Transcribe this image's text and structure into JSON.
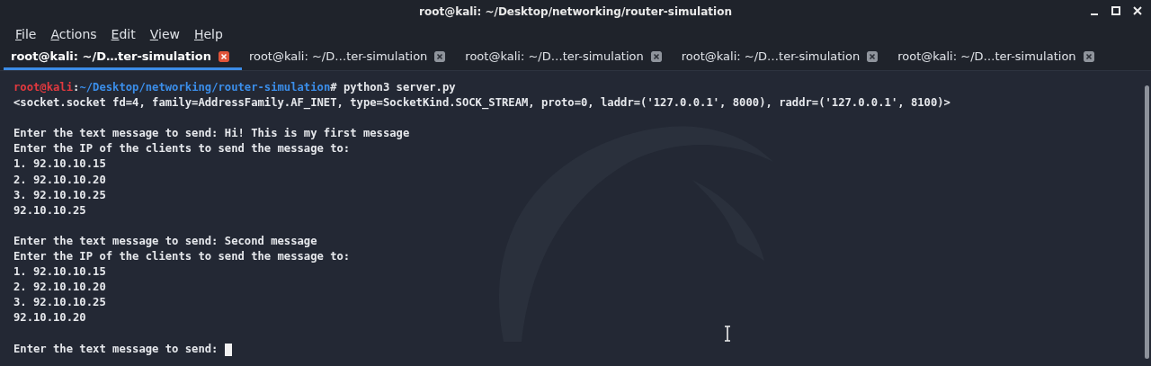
{
  "window": {
    "title": "root@kali: ~/Desktop/networking/router-simulation"
  },
  "menu": [
    "File",
    "Actions",
    "Edit",
    "View",
    "Help"
  ],
  "tabs": [
    {
      "label": "root@kali: ~/D…ter-simulation",
      "selected": true
    },
    {
      "label": "root@kali: ~/D…ter-simulation",
      "selected": false
    },
    {
      "label": "root@kali: ~/D…ter-simulation",
      "selected": false
    },
    {
      "label": "root@kali: ~/D…ter-simulation",
      "selected": false
    },
    {
      "label": "root@kali: ~/D…ter-simulation",
      "selected": false
    }
  ],
  "terminal": {
    "lines": [
      {
        "kind": "prompt",
        "user_host": "root@kali",
        "separator": ":",
        "path": "~/Desktop/networking/router-simulation",
        "symbol": "#",
        "command": " python3 server.py"
      },
      {
        "kind": "output",
        "text": "<socket.socket fd=4, family=AddressFamily.AF_INET, type=SocketKind.SOCK_STREAM, proto=0, laddr=('127.0.0.1', 8000), raddr=('127.0.0.1', 8100)>"
      },
      {
        "kind": "blank"
      },
      {
        "kind": "output",
        "text": "Enter the text message to send: Hi! This is my first message"
      },
      {
        "kind": "output",
        "text": "Enter the IP of the clients to send the message to:"
      },
      {
        "kind": "output",
        "text": "1. 92.10.10.15"
      },
      {
        "kind": "output",
        "text": "2. 92.10.10.20"
      },
      {
        "kind": "output",
        "text": "3. 92.10.10.25"
      },
      {
        "kind": "output",
        "text": "92.10.10.25"
      },
      {
        "kind": "blank"
      },
      {
        "kind": "output",
        "text": "Enter the text message to send: Second message"
      },
      {
        "kind": "output",
        "text": "Enter the IP of the clients to send the message to:"
      },
      {
        "kind": "output",
        "text": "1. 92.10.10.15"
      },
      {
        "kind": "output",
        "text": "2. 92.10.10.20"
      },
      {
        "kind": "output",
        "text": "3. 92.10.10.25"
      },
      {
        "kind": "output",
        "text": "92.10.10.20"
      },
      {
        "kind": "blank"
      },
      {
        "kind": "input",
        "text": "Enter the text message to send: "
      }
    ]
  }
}
